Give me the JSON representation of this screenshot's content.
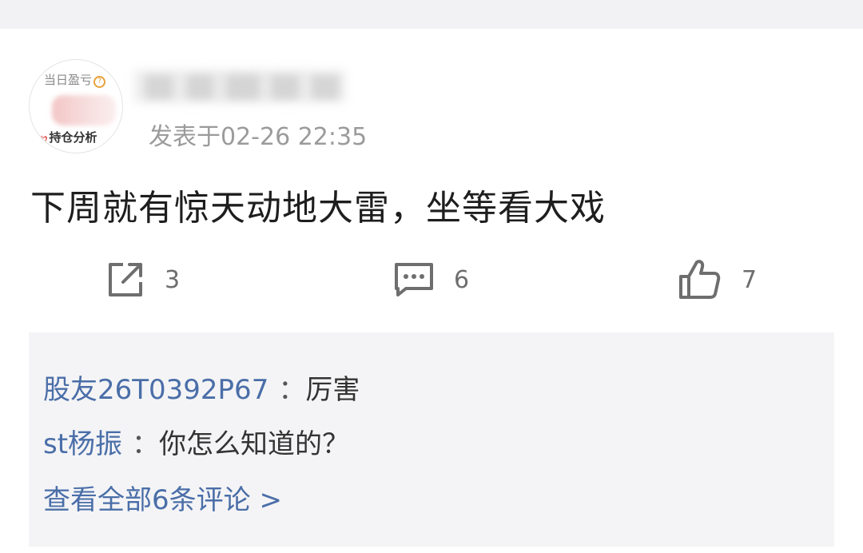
{
  "post": {
    "avatar": {
      "top_label": "当日盈亏",
      "bottom_label": "持仓分析"
    },
    "posted_time": "发表于02-26 22:35",
    "content": "下周就有惊天动地大雷，坐等看大戏",
    "actions": {
      "share_count": "3",
      "comment_count": "6",
      "like_count": "7"
    }
  },
  "comments": {
    "items": [
      {
        "user": "股友26T0392P67",
        "separator": "：",
        "text": "厉害"
      },
      {
        "user": "st杨振",
        "separator": "：",
        "text": "你怎么知道的？"
      }
    ],
    "view_all": "查看全部6条评论 >"
  },
  "colors": {
    "link_blue": "#4a6ea8",
    "muted_gray": "#9b9b9b",
    "panel_bg": "#f4f4f6"
  },
  "icons": [
    "share-icon",
    "comment-icon",
    "like-icon"
  ]
}
